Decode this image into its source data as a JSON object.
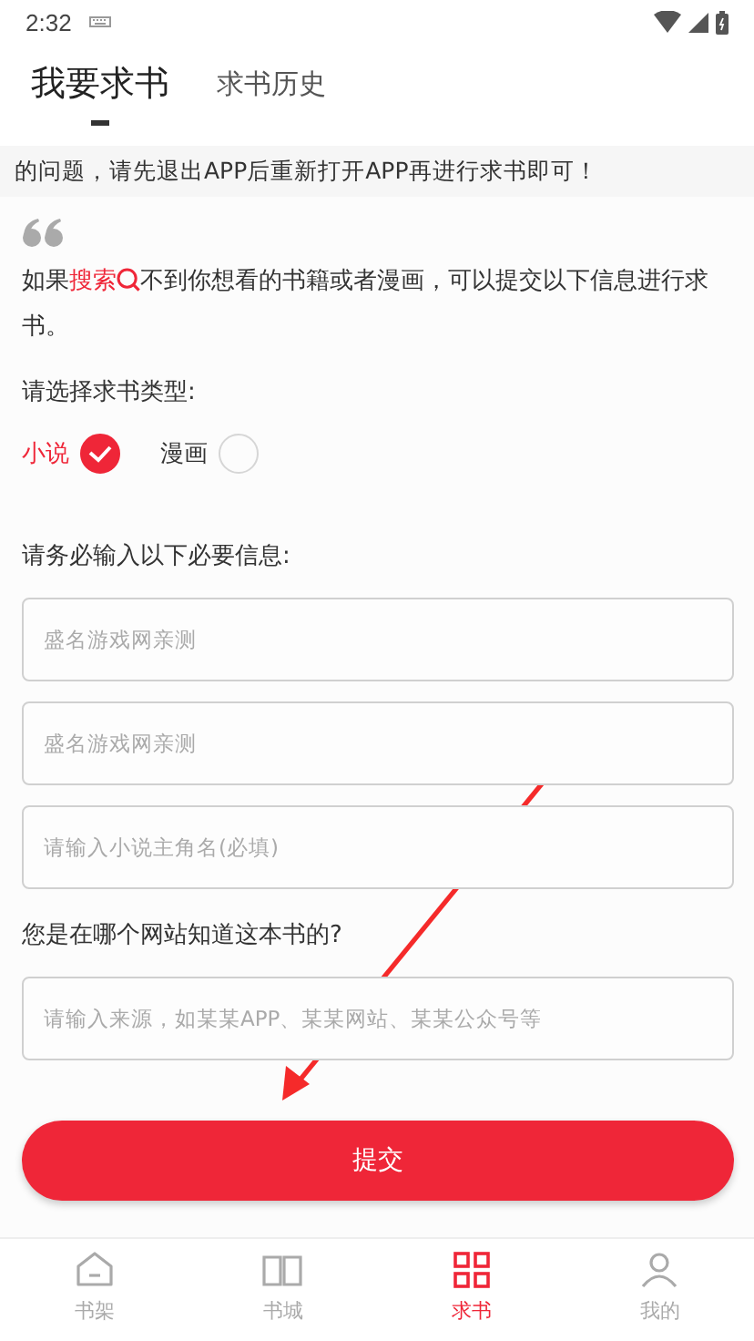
{
  "status_bar": {
    "time": "2:32"
  },
  "tabs": [
    {
      "label": "我要求书",
      "selected": true
    },
    {
      "label": "求书历史",
      "selected": false
    }
  ],
  "notice": "的问题，请先退出APP后重新打开APP再进行求书即可！",
  "intro": {
    "before": "如果",
    "link": "搜索",
    "after": "不到你想看的书籍或者漫画，可以提交以下信息进行求书。"
  },
  "type_label": "请选择求书类型:",
  "types": [
    {
      "label": "小说",
      "selected": true
    },
    {
      "label": "漫画",
      "selected": false
    }
  ],
  "required_label": "请务必输入以下必要信息:",
  "fields": [
    {
      "placeholder": "盛名游戏网亲测"
    },
    {
      "placeholder": "盛名游戏网亲测"
    },
    {
      "placeholder": "请输入小说主角名(必填)"
    }
  ],
  "source_label": "您是在哪个网站知道这本书的?",
  "source_field": {
    "placeholder": "请输入来源，如某某APP、某某网站、某某公众号等"
  },
  "submit": "提交",
  "nav": [
    {
      "label": "书架",
      "selected": false
    },
    {
      "label": "书城",
      "selected": false
    },
    {
      "label": "求书",
      "selected": true
    },
    {
      "label": "我的",
      "selected": false
    }
  ]
}
